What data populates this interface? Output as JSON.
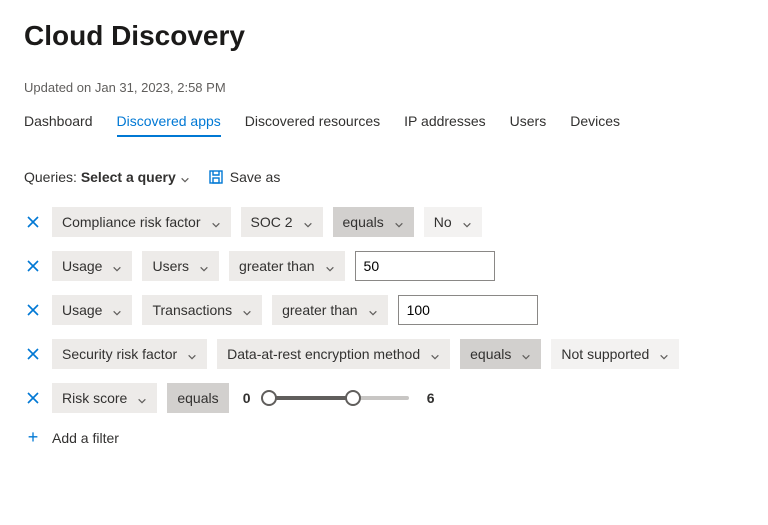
{
  "title": "Cloud Discovery",
  "updated": "Updated on Jan 31, 2023, 2:58 PM",
  "tabs": [
    {
      "label": "Dashboard"
    },
    {
      "label": "Discovered apps"
    },
    {
      "label": "Discovered resources"
    },
    {
      "label": "IP addresses"
    },
    {
      "label": "Users"
    },
    {
      "label": "Devices"
    }
  ],
  "active_tab_index": 1,
  "queries": {
    "label": "Queries:",
    "select": "Select a query",
    "saveas": "Save as"
  },
  "filters": [
    {
      "category": "Compliance risk factor",
      "subcategory": "SOC 2",
      "operator": "equals",
      "value_type": "dropdown",
      "value": "No"
    },
    {
      "category": "Usage",
      "subcategory": "Users",
      "operator": "greater than",
      "value_type": "text",
      "value": "50"
    },
    {
      "category": "Usage",
      "subcategory": "Transactions",
      "operator": "greater than",
      "value_type": "text",
      "value": "100"
    },
    {
      "category": "Security risk factor",
      "subcategory": "Data-at-rest encryption method",
      "operator": "equals",
      "value_type": "dropdown",
      "value": "Not supported"
    },
    {
      "category": "Risk score",
      "operator": "equals",
      "value_type": "range",
      "range_min": 0,
      "range_max": 6,
      "range_absolute_max": 10
    }
  ],
  "add_filter": "Add a filter"
}
